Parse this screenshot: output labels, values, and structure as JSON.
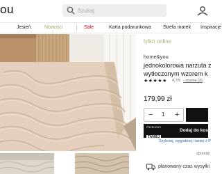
{
  "header": {
    "logo_fragment": "ou",
    "search_placeholder": "Szukaj"
  },
  "nav": {
    "items": [
      "Jesień",
      "Nowości",
      "Sale",
      "Karta podarunkowa",
      "Strefa marek",
      "Inspiracje"
    ]
  },
  "product": {
    "availability": "tylko online",
    "brand": "home&you",
    "title": "jednokolorowa narzuta z wytłoczonym wzorem k",
    "stars": "★★★★★",
    "rating": "4,7/5",
    "review_count": "- ocenie (3)",
    "price": "179,99 zł"
  },
  "purchase": {
    "quantity": "1",
    "minus": "−",
    "plus": "+",
    "pay_logo_top": "PRZELEWY",
    "pay_logo_bottom": "TANIEJ",
    "add_to_cart": "Dodaj do koszy",
    "pay_info": "Szybciej, wygodniej i taniej z P",
    "sold_by": "sprzedż"
  },
  "delivery": {
    "text": "planowany czas wysyłki"
  },
  "colors": {
    "accent_online": "#a6b27a",
    "sale": "#d0021b",
    "link": "#2d5fb5",
    "button": "#111111"
  }
}
